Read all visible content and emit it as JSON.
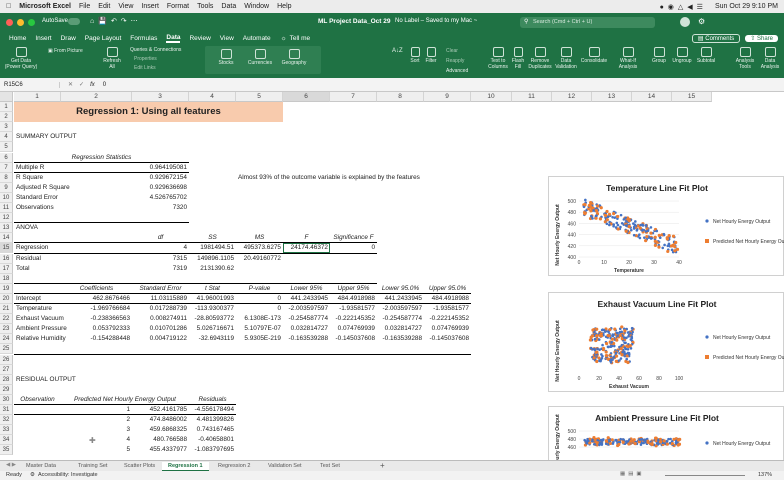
{
  "menubar": {
    "app": "Microsoft Excel",
    "items": [
      "File",
      "Edit",
      "View",
      "Insert",
      "Format",
      "Tools",
      "Data",
      "Window",
      "Help"
    ],
    "clock": "Sun Oct 29  9:10 PM"
  },
  "titlebar": {
    "autosave": "AutoSave",
    "title": "ML Project Data_Oct 29",
    "label": "No Label – Saved to my Mac ~",
    "search": "Search (Cmd + Ctrl + U)"
  },
  "tabs": [
    "Home",
    "Insert",
    "Draw",
    "Page Layout",
    "Formulas",
    "Data",
    "Review",
    "View",
    "Automate",
    "Tell me"
  ],
  "active_tab": "Data",
  "buttons": {
    "comments": "Comments",
    "share": "Share"
  },
  "ribbon": {
    "get_data": "Get Data (Power Query)",
    "from_picture": "From Picture",
    "refresh": "Refresh All",
    "queries": "Queries & Connections",
    "properties": "Properties",
    "edit_links": "Edit Links",
    "stocks": "Stocks",
    "currencies": "Currencies",
    "geography": "Geography",
    "sort": "Sort",
    "filter": "Filter",
    "clear": "Clear",
    "reapply": "Reapply",
    "advanced": "Advanced",
    "text_to_columns": "Text to Columns",
    "flash_fill": "Flash Fill",
    "remove_duplicates": "Remove Duplicates",
    "data_validation": "Data Validation",
    "consolidate": "Consolidate",
    "what_if": "What-If Analysis",
    "group": "Group",
    "ungroup": "Ungroup",
    "subtotal": "Subtotal",
    "analysis_tools": "Analysis Tools",
    "data_analysis": "Data Analysis"
  },
  "formula_bar": {
    "namebox": "R15C6",
    "fx": "fx",
    "value": "0"
  },
  "columns": [
    "1",
    "2",
    "3",
    "4",
    "5",
    "6",
    "7",
    "8",
    "9",
    "10",
    "11",
    "12",
    "13",
    "14",
    "15"
  ],
  "rows": [
    "1",
    "2",
    "3",
    "4",
    "5",
    "6",
    "7",
    "8",
    "9",
    "10",
    "11",
    "12",
    "13",
    "14",
    "15",
    "16",
    "17",
    "18",
    "19",
    "20",
    "21",
    "22",
    "23",
    "24",
    "25",
    "26",
    "27",
    "28",
    "29",
    "30",
    "31",
    "32",
    "33",
    "34",
    "35"
  ],
  "sheet": {
    "title": "Regression 1: Using all features",
    "summary_output": "SUMMARY OUTPUT",
    "reg_stats_title": "Regression Statistics",
    "reg_stats": [
      [
        "Multiple R",
        "0.964195081"
      ],
      [
        "R Square",
        "0.929672154"
      ],
      [
        "Adjusted R Square",
        "0.929636698"
      ],
      [
        "Standard Error",
        "4.526765702"
      ],
      [
        "Observations",
        "7320"
      ]
    ],
    "note": "Almost 93% of the outcome variable is explained by the features",
    "anova": "ANOVA",
    "anova_headers": [
      "df",
      "SS",
      "MS",
      "F",
      "Significance F"
    ],
    "anova_rows": [
      [
        "Regression",
        "4",
        "1981494.51",
        "495373.6275",
        "24174.46372",
        "0"
      ],
      [
        "Residual",
        "7315",
        "149896.1105",
        "20.49160772",
        "",
        ""
      ],
      [
        "Total",
        "7319",
        "2131390.62",
        "",
        "",
        ""
      ]
    ],
    "coef_headers": [
      "Coefficients",
      "Standard Error",
      "t Stat",
      "P-value",
      "Lower 95%",
      "Upper 95%",
      "Lower 95.0%",
      "Upper 95.0%"
    ],
    "coef_rows": [
      [
        "Intercept",
        "462.8676466",
        "11.03115889",
        "41.96001993",
        "0",
        "441.2433945",
        "484.4918988",
        "441.2433945",
        "484.4918988"
      ],
      [
        "Temperature",
        "-1.969766684",
        "0.017288739",
        "-113.9300377",
        "0",
        "-2.003597597",
        "-1.93581577",
        "-2.003597597",
        "-1.93581577"
      ],
      [
        "Exhaust Vacuum",
        "-0.238366563",
        "0.008274911",
        "-28.80593772",
        "6.1308E-173",
        "-0.254587774",
        "-0.222145352",
        "-0.254587774",
        "-0.222145352"
      ],
      [
        "Ambient Pressure",
        "0.053792333",
        "0.010701286",
        "5.026716671",
        "5.10797E-07",
        "0.032814727",
        "0.074769939",
        "0.032814727",
        "0.074769939"
      ],
      [
        "Relative Humidity",
        "-0.154288448",
        "0.004719122",
        "-32.6943119",
        "5.9305E-219",
        "-0.163539288",
        "-0.145037608",
        "-0.163539288",
        "-0.145037608"
      ]
    ],
    "residual_output": "RESIDUAL OUTPUT",
    "resid_headers": [
      "Observation",
      "Predicted Net Hourly Energy Output",
      "Residuals"
    ],
    "resid_rows": [
      [
        "1",
        "452.4161785",
        "-4.556178494"
      ],
      [
        "2",
        "474.8486002",
        "4.481399826"
      ],
      [
        "3",
        "459.6868325",
        "0.743167465"
      ],
      [
        "4",
        "480.766588",
        "-0.40658801"
      ],
      [
        "5",
        "455.4337977",
        "-1.083797695"
      ]
    ]
  },
  "charts": [
    {
      "title": "Temperature Line Fit  Plot",
      "xlabel": "Temperature",
      "ylabel": "Net Hourly Energy Output",
      "yticks": [
        "500",
        "480",
        "460",
        "440",
        "420",
        "400"
      ],
      "xticks": [
        "0",
        "10",
        "20",
        "30",
        "40"
      ],
      "legend": [
        "Net Hourly Energy Output",
        "Predicted Net Hourly Energy Output"
      ]
    },
    {
      "title": "Exhaust Vacuum  Line Fit  Plot",
      "xlabel": "Exhaust Vacuum",
      "ylabel": "Net Hourly Energy Output",
      "xticks": [
        "0",
        "20",
        "40",
        "60",
        "80",
        "100"
      ],
      "legend": [
        "Net Hourly Energy Output",
        "Predicted Net Hourly Energy Output"
      ]
    },
    {
      "title": "Ambient Pressure Line Fit  Plot",
      "ylabel": "Net Hourly Energy Output",
      "yticks": [
        "500",
        "480",
        "460"
      ],
      "legend": [
        "Net Hourly Energy Output"
      ]
    }
  ],
  "colors": {
    "excel_green": "#1f7244",
    "title_fill": "#f8cbad",
    "actual": "#4472c4",
    "predicted": "#ed7d31"
  },
  "sheet_tabs": [
    "Master Data",
    "Training Set",
    "Scatter Plots",
    "Regression 1",
    "Regression 2",
    "Validation Set",
    "Test Set"
  ],
  "active_sheet": "Regression 1",
  "status": {
    "ready": "Ready",
    "accessibility": "Accessibility: Investigate",
    "zoom": "137%"
  }
}
